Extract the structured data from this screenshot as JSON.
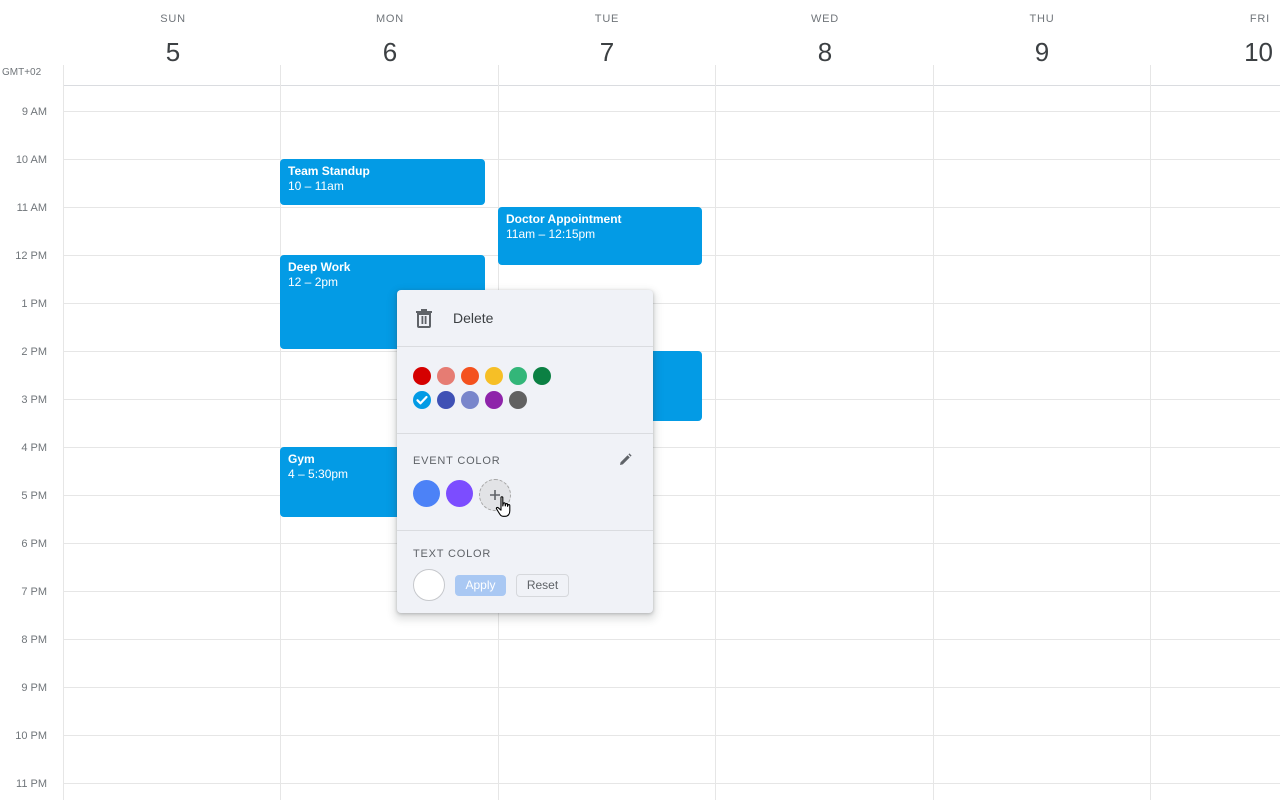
{
  "calendar": {
    "timezone": "GMT+02",
    "days": [
      {
        "name": "SUN",
        "number": "5"
      },
      {
        "name": "MON",
        "number": "6"
      },
      {
        "name": "TUE",
        "number": "7"
      },
      {
        "name": "WED",
        "number": "8"
      },
      {
        "name": "THU",
        "number": "9"
      },
      {
        "name": "FRI",
        "number": "10"
      }
    ],
    "hours": [
      "9 AM",
      "10 AM",
      "11 AM",
      "12 PM",
      "1 PM",
      "2 PM",
      "3 PM",
      "4 PM",
      "5 PM",
      "6 PM",
      "7 PM",
      "8 PM",
      "9 PM",
      "10 PM",
      "11 PM"
    ]
  },
  "events": [
    {
      "title": "Team Standup",
      "time": "10 – 11am",
      "day": "MON",
      "color": "#039be5"
    },
    {
      "title": "Doctor Appointment",
      "time": "11am – 12:15pm",
      "day": "TUE",
      "color": "#039be5"
    },
    {
      "title": "Deep Work",
      "time": "12 – 2pm",
      "day": "MON",
      "color": "#039be5"
    },
    {
      "title": "",
      "time": "",
      "day": "TUE",
      "color": "#039be5"
    },
    {
      "title": "Gym",
      "time": "4 – 5:30pm",
      "day": "MON",
      "color": "#039be5"
    }
  ],
  "context_menu": {
    "delete_label": "Delete",
    "delete_icon": "trash-icon",
    "palette": [
      {
        "name": "tomato",
        "color": "#d50000",
        "selected": false
      },
      {
        "name": "flamingo",
        "color": "#e67c73",
        "selected": false
      },
      {
        "name": "tangerine",
        "color": "#f4511e",
        "selected": false
      },
      {
        "name": "banana",
        "color": "#f6bf26",
        "selected": false
      },
      {
        "name": "sage",
        "color": "#33b679",
        "selected": false
      },
      {
        "name": "basil",
        "color": "#0b8043",
        "selected": false
      },
      {
        "name": "peacock",
        "color": "#039be5",
        "selected": true
      },
      {
        "name": "blueberry",
        "color": "#3f51b5",
        "selected": false
      },
      {
        "name": "lavender",
        "color": "#7986cb",
        "selected": false
      },
      {
        "name": "grape",
        "color": "#8e24aa",
        "selected": false
      },
      {
        "name": "graphite",
        "color": "#616161",
        "selected": false
      }
    ],
    "event_color_label": "EVENT COLOR",
    "custom_colors": [
      "#4c82f7",
      "#7c4dff"
    ],
    "text_color_label": "TEXT COLOR",
    "text_color": "#ffffff",
    "apply_label": "Apply",
    "reset_label": "Reset"
  }
}
